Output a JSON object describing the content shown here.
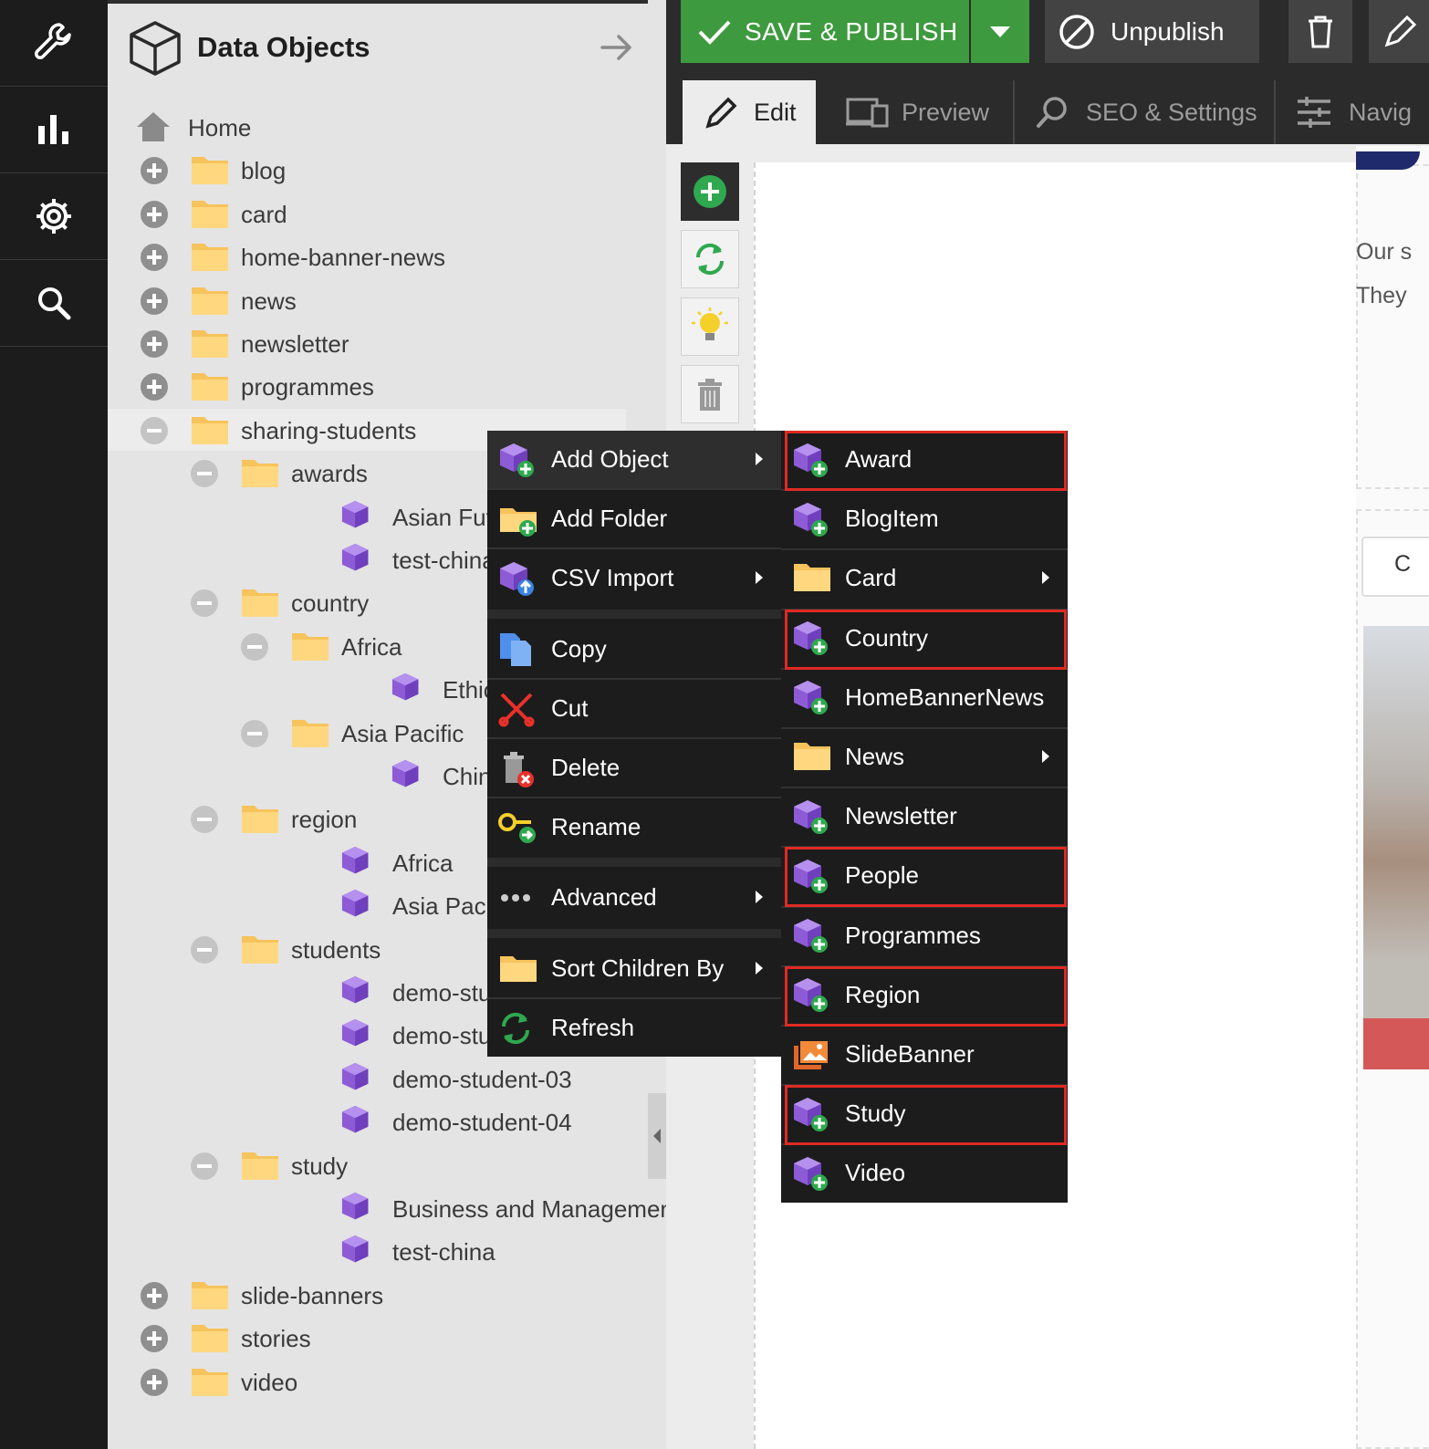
{
  "left_rail": {
    "items": [
      {
        "icon": "wrench-icon"
      },
      {
        "icon": "bar-chart-icon"
      },
      {
        "icon": "gear-icon"
      },
      {
        "icon": "search-icon"
      }
    ]
  },
  "tree_panel": {
    "title": "Data Objects",
    "items": [
      {
        "label": "Home",
        "type": "home"
      },
      {
        "label": "blog",
        "type": "folder",
        "toggle": "plus"
      },
      {
        "label": "card",
        "type": "folder",
        "toggle": "plus"
      },
      {
        "label": "home-banner-news",
        "type": "folder",
        "toggle": "plus"
      },
      {
        "label": "news",
        "type": "folder",
        "toggle": "plus"
      },
      {
        "label": "newsletter",
        "type": "folder",
        "toggle": "plus"
      },
      {
        "label": "programmes",
        "type": "folder",
        "toggle": "plus"
      },
      {
        "label": "sharing-students",
        "type": "folder",
        "toggle": "minus",
        "selected": true
      },
      {
        "label": "awards",
        "type": "folder",
        "toggle": "minus"
      },
      {
        "label": "Asian Future",
        "type": "object"
      },
      {
        "label": "test-china",
        "type": "object"
      },
      {
        "label": "country",
        "type": "folder",
        "toggle": "minus"
      },
      {
        "label": "Africa",
        "type": "folder",
        "toggle": "minus"
      },
      {
        "label": "Ethiopia",
        "type": "object"
      },
      {
        "label": "Asia Pacific",
        "type": "folder",
        "toggle": "minus"
      },
      {
        "label": "China",
        "type": "object"
      },
      {
        "label": "region",
        "type": "folder",
        "toggle": "minus"
      },
      {
        "label": "Africa",
        "type": "object"
      },
      {
        "label": "Asia Pacific",
        "type": "object"
      },
      {
        "label": "students",
        "type": "folder",
        "toggle": "minus"
      },
      {
        "label": "demo-studen",
        "type": "object"
      },
      {
        "label": "demo-studen",
        "type": "object"
      },
      {
        "label": "demo-student-03",
        "type": "object"
      },
      {
        "label": "demo-student-04",
        "type": "object"
      },
      {
        "label": "study",
        "type": "folder",
        "toggle": "minus"
      },
      {
        "label": "Business and Management",
        "type": "object"
      },
      {
        "label": "test-china",
        "type": "object"
      },
      {
        "label": "slide-banners",
        "type": "folder",
        "toggle": "plus"
      },
      {
        "label": "stories",
        "type": "folder",
        "toggle": "plus"
      },
      {
        "label": "video",
        "type": "folder",
        "toggle": "plus"
      }
    ]
  },
  "toolbar": {
    "save_publish": "SAVE & PUBLISH",
    "unpublish": "Unpublish"
  },
  "tabs": {
    "edit": "Edit",
    "preview": "Preview",
    "seo": "SEO & Settings",
    "navigation": "Navig"
  },
  "right_strip": {
    "line1": "Our s",
    "line2": "They",
    "input_text": "C"
  },
  "context_menu": {
    "add_object": "Add Object",
    "add_folder": "Add Folder",
    "csv_import": "CSV Import",
    "copy": "Copy",
    "cut": "Cut",
    "delete": "Delete",
    "rename": "Rename",
    "advanced": "Advanced",
    "sort_children_by": "Sort Children By",
    "refresh": "Refresh"
  },
  "submenu": {
    "items": [
      {
        "label": "Award",
        "icon": "object",
        "highlighted": true
      },
      {
        "label": "BlogItem",
        "icon": "object"
      },
      {
        "label": "Card",
        "icon": "folder",
        "has_submenu": true
      },
      {
        "label": "Country",
        "icon": "object",
        "highlighted": true
      },
      {
        "label": "HomeBannerNews",
        "icon": "object"
      },
      {
        "label": "News",
        "icon": "folder",
        "has_submenu": true
      },
      {
        "label": "Newsletter",
        "icon": "object"
      },
      {
        "label": "People",
        "icon": "object",
        "highlighted": true
      },
      {
        "label": "Programmes",
        "icon": "object"
      },
      {
        "label": "Region",
        "icon": "object",
        "highlighted": true
      },
      {
        "label": "SlideBanner",
        "icon": "image"
      },
      {
        "label": "Study",
        "icon": "object",
        "highlighted": true
      },
      {
        "label": "Video",
        "icon": "object"
      }
    ]
  },
  "colors": {
    "save_green": "#3e9a3e",
    "highlight_red": "#e02a23",
    "cube_purple": "#8e5bd6",
    "folder_yellow": "#f7c35c"
  }
}
